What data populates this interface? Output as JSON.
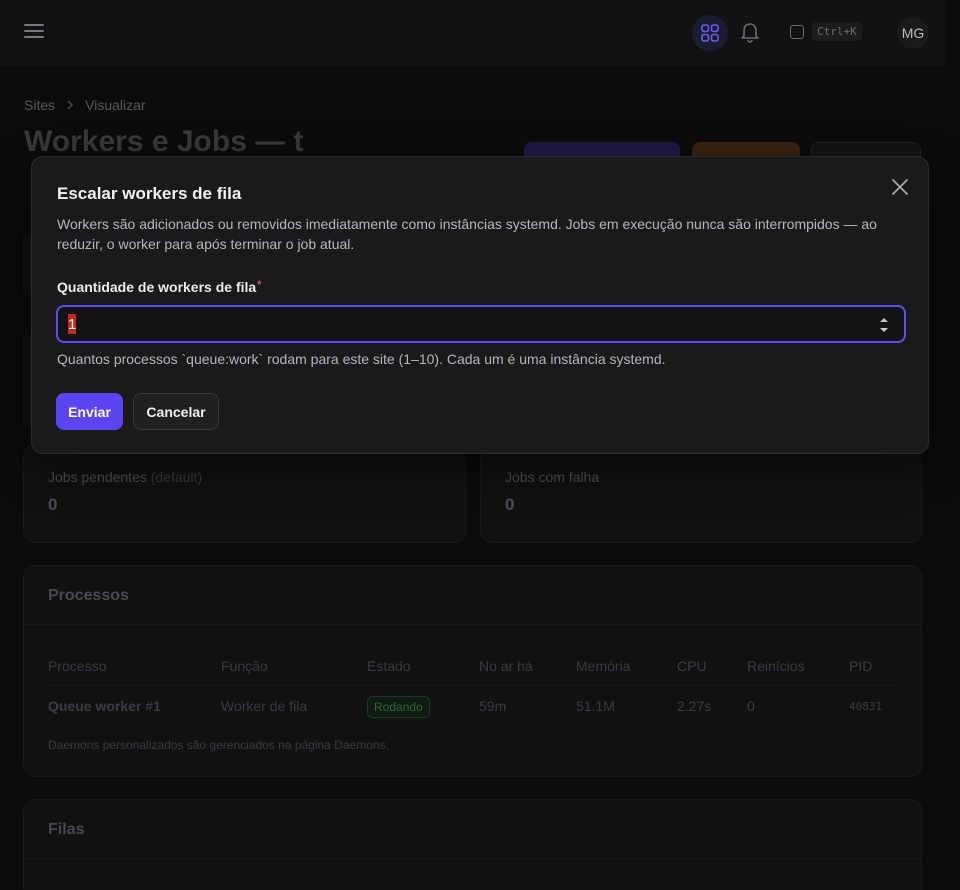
{
  "topbar": {
    "shortcut": "Ctrl+K",
    "avatar_initials": "MG"
  },
  "breadcrumb": {
    "items": [
      "Sites",
      "Visualizar"
    ]
  },
  "page": {
    "title": "Workers e Jobs — t"
  },
  "stats": {
    "pending": {
      "label": "Jobs pendentes",
      "suffix": "(default)",
      "value": "0"
    },
    "failed": {
      "label": "Jobs com falha",
      "value": "0"
    }
  },
  "processes": {
    "title": "Processos",
    "columns": [
      "Processo",
      "Função",
      "Estado",
      "No ar há",
      "Memória",
      "CPU",
      "Reinícios",
      "PID"
    ],
    "rows": [
      {
        "process": "Queue worker #1",
        "role": "Worker de fila",
        "state": "Rodando",
        "uptime": "59m",
        "memory": "51.1M",
        "cpu": "2.27s",
        "restarts": "0",
        "pid": "40831"
      }
    ],
    "footnote": "Daemons personalizados são gerenciados na página Daemons."
  },
  "queues": {
    "title": "Filas"
  },
  "modal": {
    "title": "Escalar workers de fila",
    "description": "Workers são adicionados ou removidos imediatamente como instâncias systemd. Jobs em execução nunca são interrompidos — ao reduzir, o worker para após terminar o job atual.",
    "field_label": "Quantidade de workers de fila",
    "required_mark": "*",
    "field_value": "1",
    "helper": "Quantos processos `queue:work` rodam para este site (1–10). Cada um é uma instância systemd.",
    "submit_label": "Enviar",
    "cancel_label": "Cancelar"
  },
  "colors": {
    "accent": "#5b44f2",
    "focus_border": "#5b4ff0",
    "modal_bg": "#1a1a1c",
    "page_bg": "#0b0b0c"
  },
  "icons": [
    "menu-icon",
    "apps-grid-icon",
    "bell-icon",
    "command-icon",
    "chevron-right-icon",
    "close-icon",
    "spinner-arrows-icon"
  ]
}
